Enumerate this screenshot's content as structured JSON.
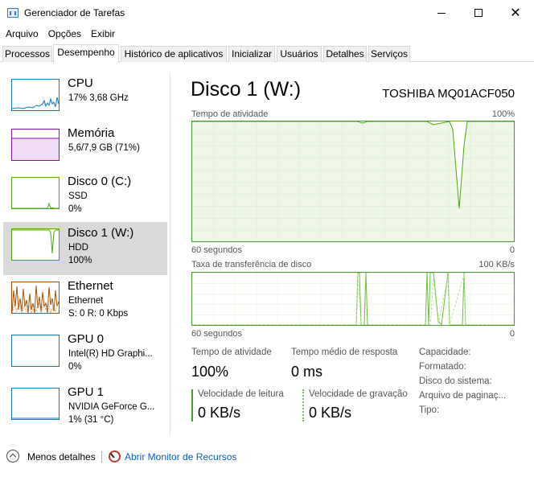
{
  "window": {
    "title": "Gerenciador de Tarefas"
  },
  "menu": [
    "Arquivo",
    "Opções",
    "Exibir"
  ],
  "tabs": [
    "Processos",
    "Desempenho",
    "Histórico de aplicativos",
    "Inicializar",
    "Usuários",
    "Detalhes",
    "Serviços"
  ],
  "active_tab": "Desempenho",
  "sidebar": [
    {
      "title": "CPU",
      "line1": "17% 3,68 GHz",
      "line2": "",
      "color": "#117dbb",
      "icon": "cpu-graph"
    },
    {
      "title": "Memória",
      "line1": "5,6/7,9 GB (71%)",
      "line2": "",
      "color": "#8b12ae",
      "icon": "memory-graph"
    },
    {
      "title": "Disco 0 (C:)",
      "line1": "SSD",
      "line2": "0%",
      "color": "#4da60c",
      "icon": "disk-graph"
    },
    {
      "title": "Disco 1 (W:)",
      "line1": "HDD",
      "line2": "100%",
      "color": "#4da60c",
      "icon": "disk-graph"
    },
    {
      "title": "Ethernet",
      "line1": "Ethernet",
      "line2": "S: 0  R: 0 Kbps",
      "color": "#a74f01",
      "icon": "network-graph"
    },
    {
      "title": "GPU 0",
      "line1": "Intel(R) HD Graphi...",
      "line2": "0%",
      "color": "#117dbb",
      "icon": "gpu-graph"
    },
    {
      "title": "GPU 1",
      "line1": "NVIDIA GeForce G...",
      "line2": "1% (31 °C)",
      "color": "#117dbb",
      "icon": "gpu-graph"
    }
  ],
  "selected_item": "Disco 1 (W:)",
  "detail": {
    "title": "Disco 1 (W:)",
    "model": "TOSHIBA MQ01ACF050",
    "graph1": {
      "label": "Tempo de atividade",
      "max": "100%",
      "time_left": "60 segundos",
      "time_right": "0"
    },
    "graph2": {
      "label": "Taxa de transferência de disco",
      "max": "100 KB/s",
      "time_left": "60 segundos",
      "time_right": "0"
    },
    "stats": {
      "active_label": "Tempo de atividade",
      "active_value": "100%",
      "avg_label": "Tempo médio de resposta",
      "avg_value": "0 ms",
      "read_label": "Velocidade de leitura",
      "read_value": "0 KB/s",
      "write_label": "Velocidade de gravação",
      "write_value": "0 KB/s"
    },
    "properties": [
      "Capacidade:",
      "Formatado:",
      "Disco do sistema:",
      "Arquivo de paginaç...",
      "Tipo:"
    ]
  },
  "footer": {
    "less": "Menos detalhes",
    "monitor": "Abrir Monitor de Recursos"
  },
  "colors": {
    "disk": "#4da60c",
    "grid": "#e1f0d6",
    "link": "#0b5ec7"
  }
}
